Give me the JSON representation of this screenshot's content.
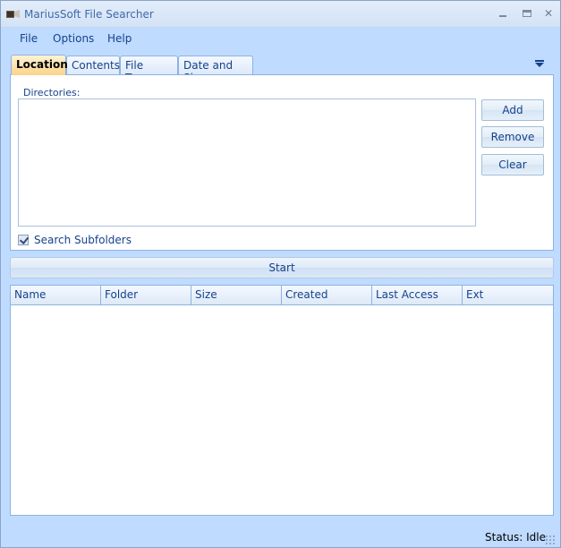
{
  "window": {
    "title": "MariusSoft File Searcher",
    "controls": {
      "minimize": "minimize",
      "maximize": "maximize",
      "close": "close"
    }
  },
  "menu": {
    "items": [
      {
        "label": "File"
      },
      {
        "label": "Options"
      },
      {
        "label": "Help"
      }
    ]
  },
  "tabs": [
    {
      "label": "Location",
      "active": true
    },
    {
      "label": "Contents",
      "active": false
    },
    {
      "label": "File Types",
      "active": false
    },
    {
      "label": "Date and Size",
      "active": false
    }
  ],
  "location": {
    "directories_label": "Directories:",
    "directories": [],
    "buttons": {
      "add": "Add",
      "remove": "Remove",
      "clear": "Clear"
    },
    "search_subfolders": {
      "label": "Search Subfolders",
      "checked": true
    }
  },
  "start_label": "Start",
  "results": {
    "columns": [
      "Name",
      "Folder",
      "Size",
      "Created",
      "Last Access",
      "Ext"
    ],
    "rows": []
  },
  "status": {
    "label": "Status:",
    "value": "Idle"
  }
}
